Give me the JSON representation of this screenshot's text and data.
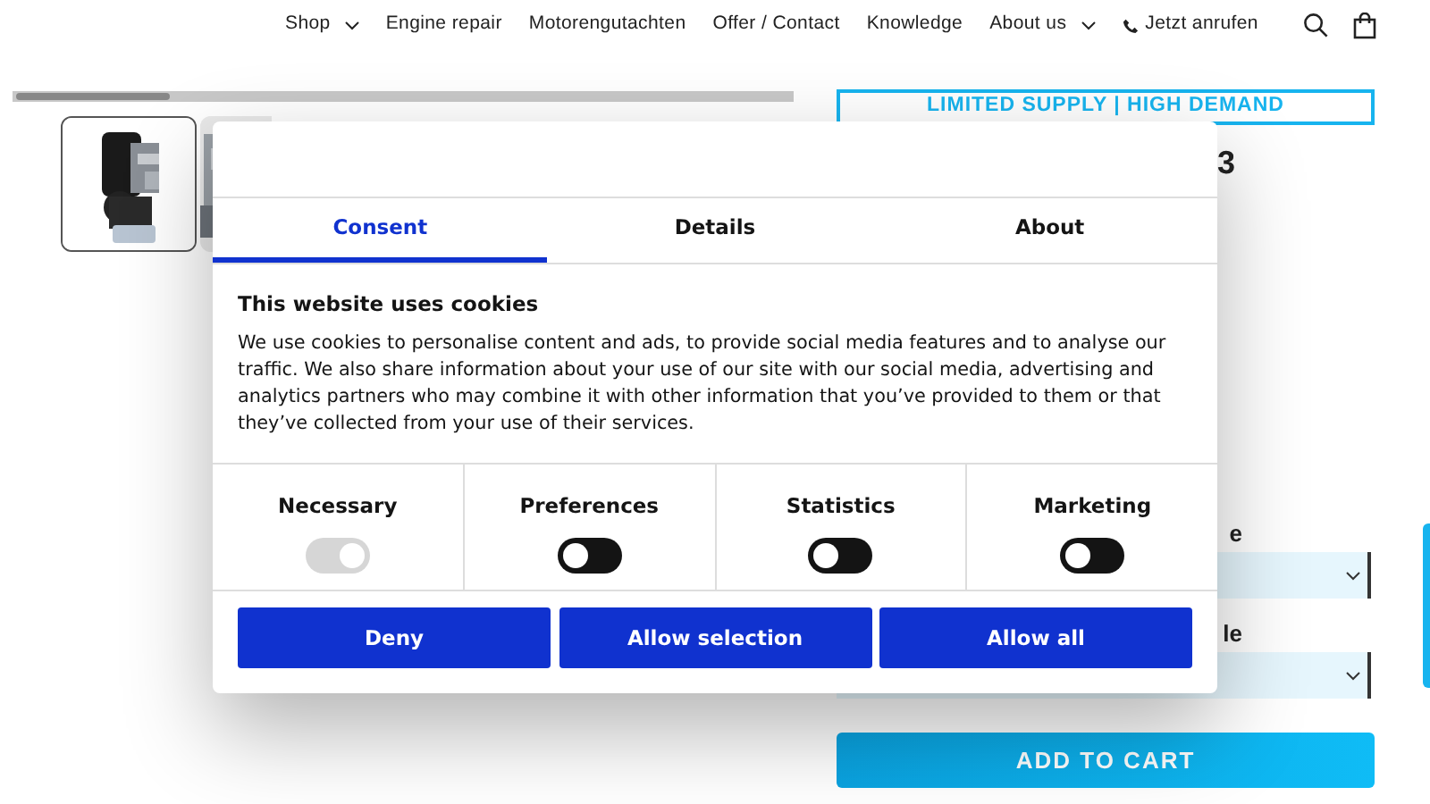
{
  "nav": {
    "items": [
      {
        "label": "Shop",
        "dropdown": true
      },
      {
        "label": "Engine repair",
        "dropdown": false
      },
      {
        "label": "Motorengutachten",
        "dropdown": false
      },
      {
        "label": "Offer / Contact",
        "dropdown": false
      },
      {
        "label": "Knowledge",
        "dropdown": false
      },
      {
        "label": "About us",
        "dropdown": true
      },
      {
        "label": "Jetzt anrufen",
        "dropdown": false,
        "kind": "phone"
      }
    ]
  },
  "product": {
    "banner": "LIMITED SUPPLY | HIGH DEMAND",
    "title_visible": "3",
    "options": [
      {
        "label": "e"
      },
      {
        "label": "le"
      }
    ],
    "add_to_cart": "ADD TO CART"
  },
  "cookie_dialog": {
    "tabs": [
      {
        "label": "Consent",
        "selected": true
      },
      {
        "label": "Details",
        "selected": false
      },
      {
        "label": "About",
        "selected": false
      }
    ],
    "heading": "This website uses cookies",
    "text": "We use cookies to personalise content and ads, to provide social media features and to analyse our traffic. We also share information about your use of our site with our social media, advertising and analytics partners who may combine it with other information that you’ve provided to them or that they’ve collected from your use of their services.",
    "categories": [
      {
        "label": "Necessary",
        "checked": true,
        "disabled": true
      },
      {
        "label": "Preferences",
        "checked": false,
        "disabled": false
      },
      {
        "label": "Statistics",
        "checked": false,
        "disabled": false
      },
      {
        "label": "Marketing",
        "checked": false,
        "disabled": false
      }
    ],
    "buttons": [
      "Deny",
      "Allow selection",
      "Allow all"
    ]
  }
}
